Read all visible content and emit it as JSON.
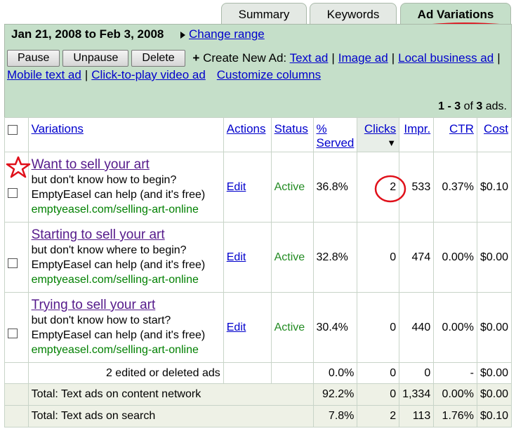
{
  "tabs": [
    {
      "label": "Summary"
    },
    {
      "label": "Keywords"
    },
    {
      "label": "Ad Variations"
    }
  ],
  "date_range": "Jan 21, 2008 to Feb 3, 2008",
  "change_range": "Change range",
  "buttons": {
    "pause": "Pause",
    "unpause": "Unpause",
    "delete": "Delete"
  },
  "create_new_ad": "Create New Ad:",
  "ad_links": {
    "text_ad": "Text ad",
    "image_ad": "Image ad",
    "local_business_ad": "Local business ad",
    "mobile_text_ad": "Mobile text ad",
    "click_to_play": "Click-to-play video ad",
    "customize_columns": "Customize columns"
  },
  "result_count": {
    "range": "1 - 3",
    "of": "of",
    "total": "3",
    "suffix": "ads."
  },
  "columns": {
    "variations": "Variations",
    "actions": "Actions",
    "status": "Status",
    "pct_served_1": "%",
    "pct_served_2": "Served",
    "clicks": "Clicks",
    "impr": "Impr.",
    "ctr": "CTR",
    "cost": "Cost"
  },
  "ads": [
    {
      "headline": "Want to sell your art",
      "line1": "but don't know how to begin?",
      "line2": "EmptyEasel can help (and it's free)",
      "url": "emptyeasel.com/selling-art-online",
      "action": "Edit",
      "status": "Active",
      "served": "36.8%",
      "clicks": "2",
      "impr": "533",
      "ctr": "0.37%",
      "cost": "$0.10"
    },
    {
      "headline": "Starting to sell your art",
      "line1": "but don't know where to begin?",
      "line2": "EmptyEasel can help (and it's free)",
      "url": "emptyeasel.com/selling-art-online",
      "action": "Edit",
      "status": "Active",
      "served": "32.8%",
      "clicks": "0",
      "impr": "474",
      "ctr": "0.00%",
      "cost": "$0.00"
    },
    {
      "headline": "Trying to sell your art",
      "line1": "but don't know how to start?",
      "line2": "EmptyEasel can help (and it's free)",
      "url": "emptyeasel.com/selling-art-online",
      "action": "Edit",
      "status": "Active",
      "served": "30.4%",
      "clicks": "0",
      "impr": "440",
      "ctr": "0.00%",
      "cost": "$0.00"
    }
  ],
  "edited_row": {
    "label": "2 edited or deleted ads",
    "served": "0.0%",
    "clicks": "0",
    "impr": "0",
    "ctr": "-",
    "cost": "$0.00"
  },
  "totals": [
    {
      "label": "Total: Text ads on content network",
      "served": "92.2%",
      "clicks": "0",
      "impr": "1,334",
      "ctr": "0.00%",
      "cost": "$0.00"
    },
    {
      "label": "Total: Text ads on search",
      "served": "7.8%",
      "clicks": "2",
      "impr": "113",
      "ctr": "1.76%",
      "cost": "$0.10"
    }
  ],
  "colors": {
    "panel": "#c5dfc9",
    "link": "#0000cc",
    "visited": "#551a8b",
    "url_green": "#008000",
    "annotation_red": "#e0101a"
  }
}
